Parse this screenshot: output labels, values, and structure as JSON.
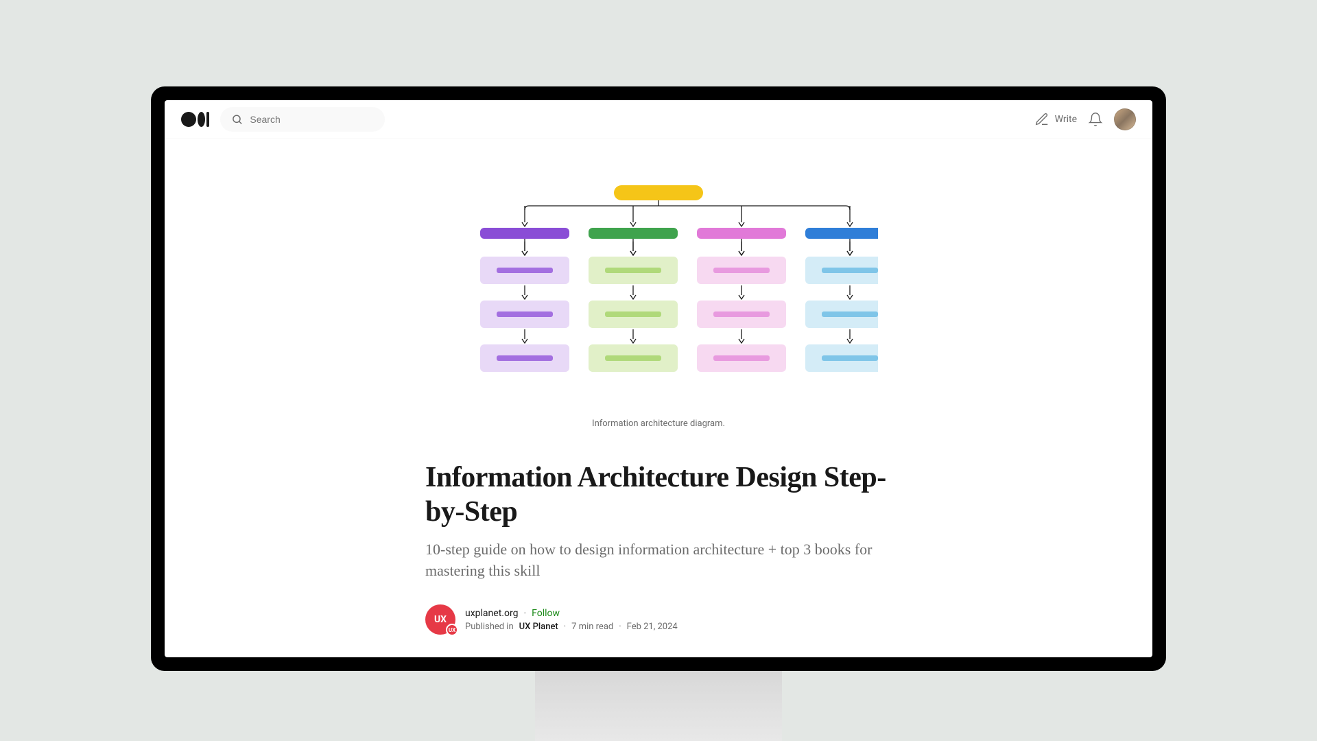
{
  "topbar": {
    "search_placeholder": "Search",
    "write_label": "Write"
  },
  "hero": {
    "caption": "Information architecture diagram."
  },
  "article": {
    "title": "Information Architecture Design Step-by-Step",
    "subtitle": "10-step guide on how to design information architecture + top 3 books for mastering this skill"
  },
  "author": {
    "avatar_text": "UX",
    "badge_text": "UX",
    "name": "uxplanet.org",
    "follow": "Follow",
    "published_in_prefix": "Published in",
    "publication": "UX Planet",
    "read_time": "7 min read",
    "date": "Feb 21, 2024"
  },
  "diagram": {
    "root_color": "#f5c518",
    "columns": [
      {
        "header": "#8a4dd6",
        "sub_bg": "#e8d9f7",
        "sub_bar": "#a36fe0"
      },
      {
        "header": "#3fa34d",
        "sub_bg": "#e1f0c8",
        "sub_bar": "#b0d97a"
      },
      {
        "header": "#e179d8",
        "sub_bg": "#f7d9f1",
        "sub_bar": "#e89adf"
      },
      {
        "header": "#2f7ed8",
        "sub_bg": "#d4ecf7",
        "sub_bar": "#7fc5e8"
      }
    ]
  }
}
